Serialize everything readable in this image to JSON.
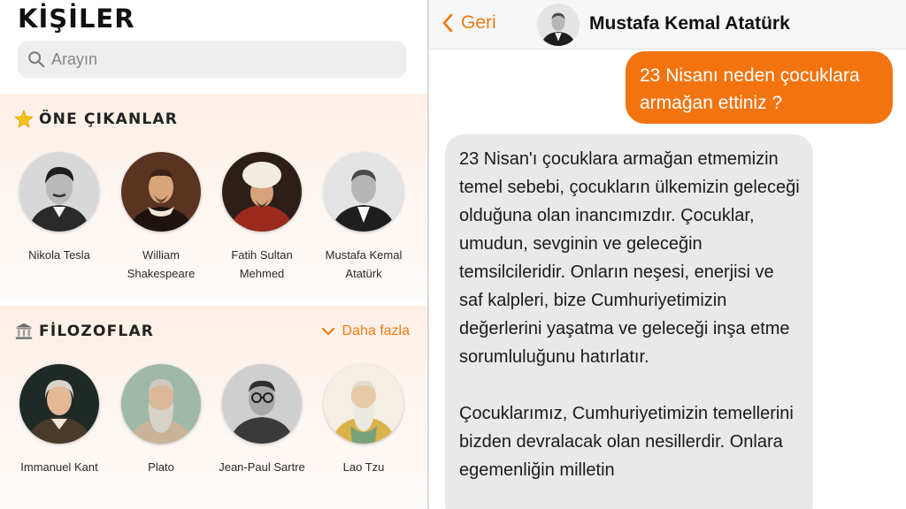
{
  "left": {
    "title": "KİŞİLER",
    "search_placeholder": "Arayın",
    "featured": {
      "icon": "star-icon",
      "title": "ÖNE ÇIKANLAR",
      "people": [
        {
          "name": "Nikola Tesla"
        },
        {
          "name": "William Shakespeare"
        },
        {
          "name": "Fatih Sultan Mehmed"
        },
        {
          "name": "Mustafa Kemal Atatürk"
        }
      ]
    },
    "philosophers": {
      "icon": "classical-building-icon",
      "title": "FİLOZOFLAR",
      "more_label": "Daha fazla",
      "people": [
        {
          "name": "Immanuel Kant"
        },
        {
          "name": "Plato"
        },
        {
          "name": "Jean-Paul Sartre"
        },
        {
          "name": "Lao Tzu"
        }
      ]
    }
  },
  "chat": {
    "back_label": "Geri",
    "contact_name": "Mustafa Kemal Atatürk",
    "messages": [
      {
        "from": "user",
        "text": "23 Nisanı neden çocuklara armağan ettiniz ?"
      },
      {
        "from": "bot",
        "paragraphs": [
          "23 Nisan'ı çocuklara armağan etmemizin temel sebebi, çocukların ülkemizin geleceği olduğuna olan inancımızdır. Çocuklar, umudun, sevginin ve geleceğin temsilcileridir. Onların neşesi, enerjisi ve saf kalpleri, bize Cumhuriyetimizin değerlerini yaşatma ve geleceği inşa etme sorumluluğunu hatırlatır.",
          "Çocuklarımız, Cumhuriyetimizin temellerini bizden devralacak olan nesillerdir. Onlara egemenliğin milletin"
        ]
      }
    ]
  },
  "colors": {
    "accent": "#f3740f",
    "incoming_bubble": "#e9e9ea",
    "section_bg": "#fcefe6"
  }
}
